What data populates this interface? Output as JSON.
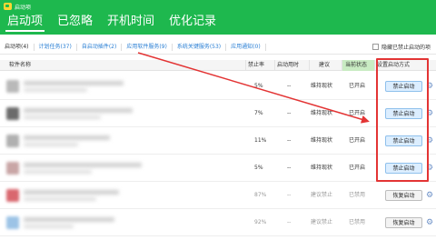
{
  "app": {
    "title": "启动项"
  },
  "tabs": [
    {
      "label": "启动项",
      "active": true
    },
    {
      "label": "已忽略",
      "active": false
    },
    {
      "label": "开机时间",
      "active": false
    },
    {
      "label": "优化记录",
      "active": false
    }
  ],
  "subtabs": [
    {
      "label": "启动项(4)",
      "active": true
    },
    {
      "label": "计划任务(37)",
      "active": false
    },
    {
      "label": "自启动插件(2)",
      "active": false
    },
    {
      "label": "应用软件服务(9)",
      "active": false
    },
    {
      "label": "系统关键服务(53)",
      "active": false
    },
    {
      "label": "应用通知(0)",
      "active": false
    }
  ],
  "hide_option": {
    "label": "隐藏已禁止启动的项",
    "checked": false
  },
  "columns": {
    "name": "软件名称",
    "disable_rate": "禁止率",
    "startup_time": "启动用时",
    "advice": "建议",
    "state": "当前状态",
    "method": "设置启动方式"
  },
  "rows": [
    {
      "rate": "5%",
      "time": "--",
      "advice": "维持现状",
      "state": "已开启",
      "action": "禁止启动",
      "type": "disable",
      "icon_color": "#b9b9b9",
      "muted": false
    },
    {
      "rate": "7%",
      "time": "--",
      "advice": "维持现状",
      "state": "已开启",
      "action": "禁止启动",
      "type": "disable",
      "icon_color": "#6b6b6b",
      "muted": false
    },
    {
      "rate": "11%",
      "time": "--",
      "advice": "维持现状",
      "state": "已开启",
      "action": "禁止启动",
      "type": "disable",
      "icon_color": "#b0b0b0",
      "muted": false
    },
    {
      "rate": "5%",
      "time": "--",
      "advice": "维持现状",
      "state": "已开启",
      "action": "禁止启动",
      "type": "disable",
      "icon_color": "#c9a6a6",
      "muted": false
    },
    {
      "rate": "87%",
      "time": "--",
      "advice": "建议禁止",
      "state": "已禁用",
      "action": "恢复启动",
      "type": "restore",
      "icon_color": "#d9676e",
      "muted": true
    },
    {
      "rate": "92%",
      "time": "--",
      "advice": "建议禁止",
      "state": "已禁用",
      "action": "恢复启动",
      "type": "restore",
      "icon_color": "#9cc3e6",
      "muted": true
    }
  ],
  "colors": {
    "header_green": "#1eb84e",
    "highlight_red": "#e33434",
    "link_blue": "#2a7fd4"
  },
  "icons": {
    "gear": "gear-icon",
    "dropdown": "chevron-down-icon"
  }
}
